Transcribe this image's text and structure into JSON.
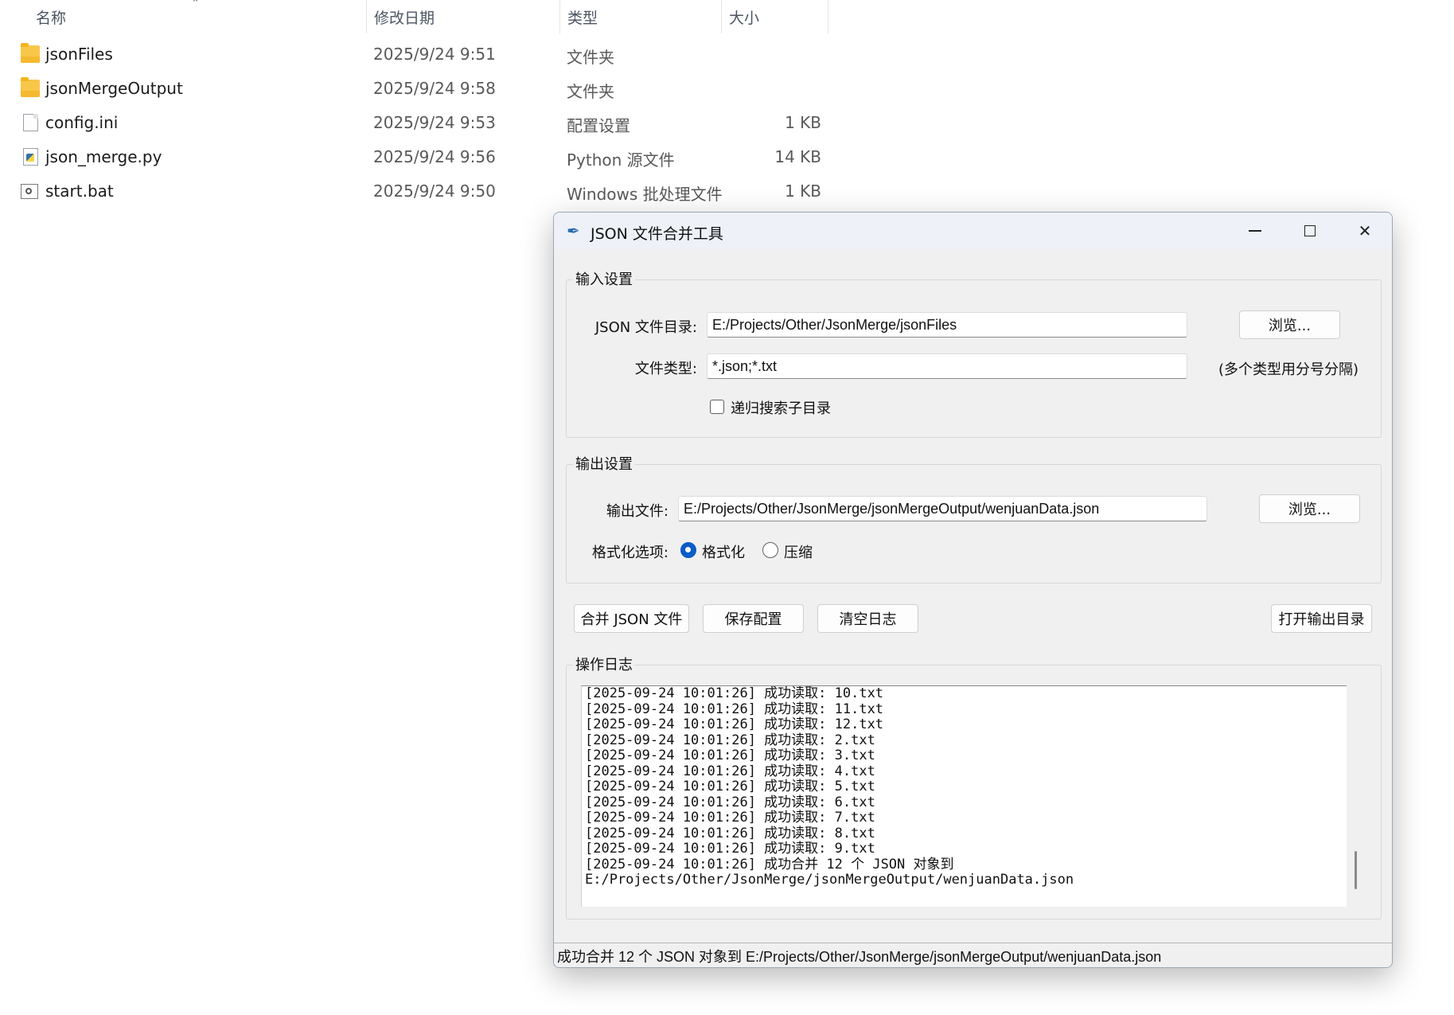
{
  "explorer": {
    "columns": {
      "name": "名称",
      "date": "修改日期",
      "type": "类型",
      "size": "大小"
    },
    "files": [
      {
        "name": "jsonFiles",
        "date": "2025/9/24 9:51",
        "type": "文件夹",
        "size": "",
        "icon": "folder-icon"
      },
      {
        "name": "jsonMergeOutput",
        "date": "2025/9/24 9:58",
        "type": "文件夹",
        "size": "",
        "icon": "folder-icon"
      },
      {
        "name": "config.ini",
        "date": "2025/9/24 9:53",
        "type": "配置设置",
        "size": "1 KB",
        "icon": "ini-file-icon"
      },
      {
        "name": "json_merge.py",
        "date": "2025/9/24 9:56",
        "type": "Python 源文件",
        "size": "14 KB",
        "icon": "python-file-icon"
      },
      {
        "name": "start.bat",
        "date": "2025/9/24 9:50",
        "type": "Windows 批处理文件",
        "size": "1 KB",
        "icon": "batch-file-icon"
      }
    ]
  },
  "dialog": {
    "title": "JSON 文件合并工具",
    "input_group": {
      "title": "输入设置",
      "dir_label": "JSON 文件目录:",
      "dir_value": "E:/Projects/Other/JsonMerge/jsonFiles",
      "browse_label": "浏览...",
      "type_label": "文件类型:",
      "type_value": "*.json;*.txt",
      "type_hint": "(多个类型用分号分隔)",
      "recursive_label": "递归搜索子目录",
      "recursive_checked": false
    },
    "output_group": {
      "title": "输出设置",
      "file_label": "输出文件:",
      "file_value": "E:/Projects/Other/JsonMerge/jsonMergeOutput/wenjuanData.json",
      "browse_label": "浏览...",
      "format_label": "格式化选项:",
      "format_option": "格式化",
      "compress_option": "压缩",
      "selected": "格式化"
    },
    "actions": {
      "merge": "合并 JSON 文件",
      "save_config": "保存配置",
      "clear_log": "清空日志",
      "open_output": "打开输出目录"
    },
    "log": {
      "title": "操作日志",
      "lines": [
        "[2025-09-24 10:01:26] 成功读取: 10.txt",
        "[2025-09-24 10:01:26] 成功读取: 11.txt",
        "[2025-09-24 10:01:26] 成功读取: 12.txt",
        "[2025-09-24 10:01:26] 成功读取: 2.txt",
        "[2025-09-24 10:01:26] 成功读取: 3.txt",
        "[2025-09-24 10:01:26] 成功读取: 4.txt",
        "[2025-09-24 10:01:26] 成功读取: 5.txt",
        "[2025-09-24 10:01:26] 成功读取: 6.txt",
        "[2025-09-24 10:01:26] 成功读取: 7.txt",
        "[2025-09-24 10:01:26] 成功读取: 8.txt",
        "[2025-09-24 10:01:26] 成功读取: 9.txt",
        "[2025-09-24 10:01:26] 成功合并 12 个 JSON 对象到",
        "E:/Projects/Other/JsonMerge/jsonMergeOutput/wenjuanData.json"
      ]
    },
    "status": "成功合并 12 个 JSON 对象到 E:/Projects/Other/JsonMerge/jsonMergeOutput/wenjuanData.json",
    "colors": {
      "accent": "#0a5cc7",
      "folder": "#f8c74a"
    }
  }
}
